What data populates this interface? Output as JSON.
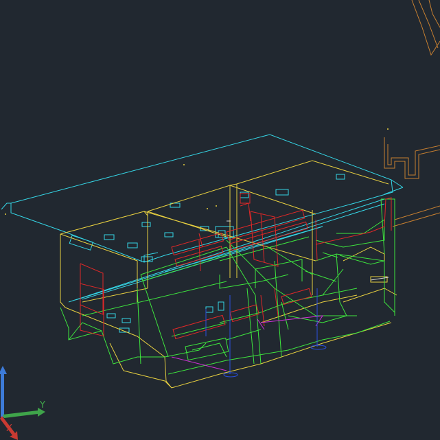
{
  "viewport": {
    "background": "#212830"
  },
  "ucs": {
    "x_label": "X",
    "y_label": "Y",
    "x_color": "#c83a32",
    "y_color": "#3fa44a",
    "z_color": "#3d7bd8"
  },
  "layer_colors": {
    "cyan": "#35d6e6",
    "yellow": "#e8d040",
    "green": "#3ee63e",
    "red": "#e02828",
    "blue": "#2a4fe0",
    "magenta": "#d030d8",
    "orange": "#c88030",
    "white": "#d8d8d8"
  }
}
